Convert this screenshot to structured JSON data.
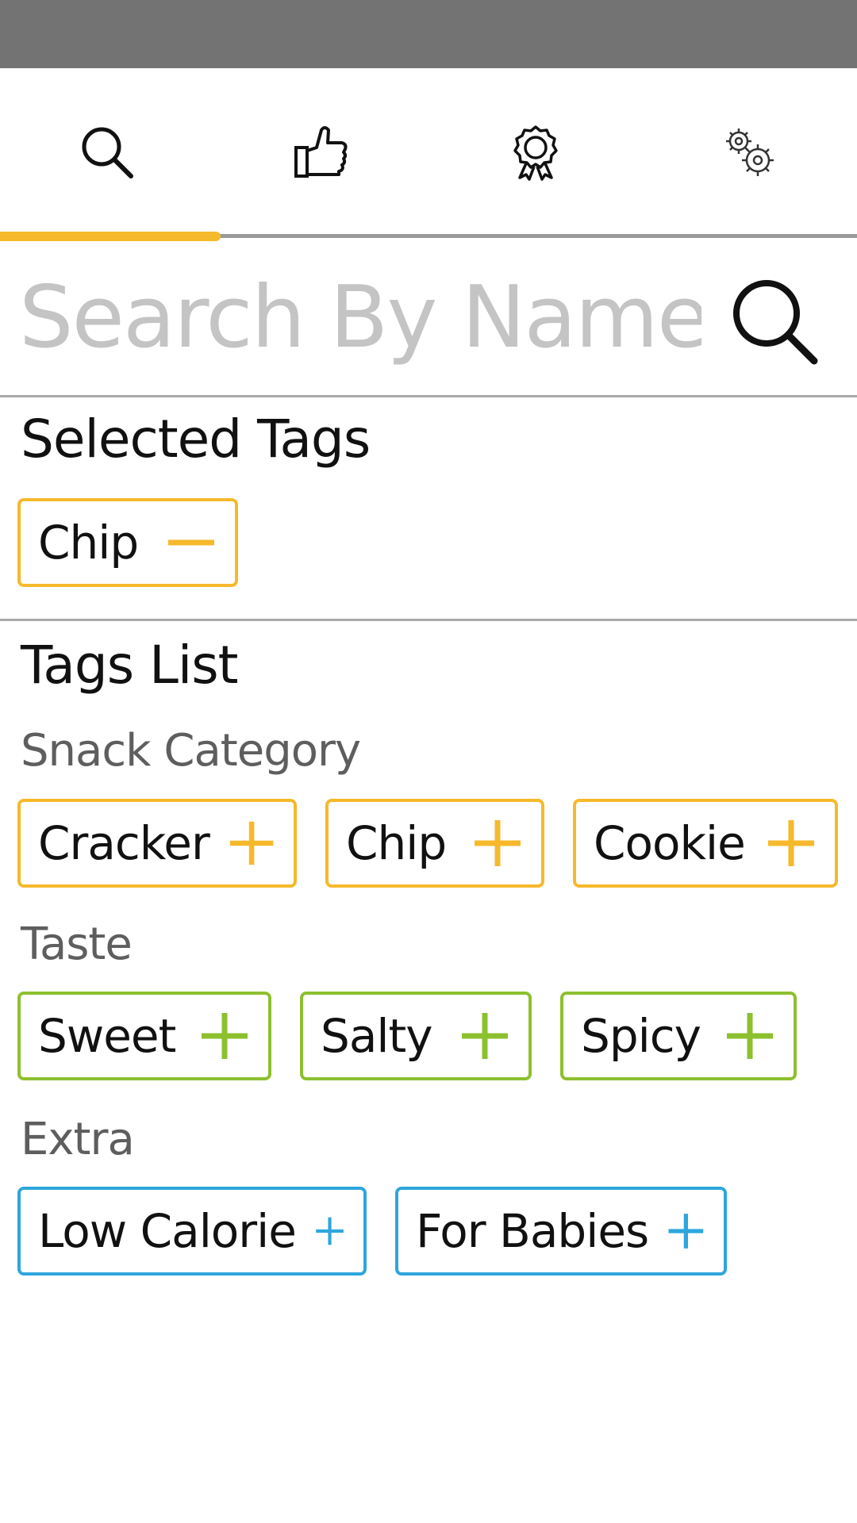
{
  "colors": {
    "accent_yellow": "#f6b92c",
    "accent_green": "#8dc02f",
    "accent_blue": "#2ea6dd",
    "divider": "#a9a9a9"
  },
  "tabs": [
    {
      "icon": "search-icon",
      "active": true
    },
    {
      "icon": "thumbs-up-icon",
      "active": false
    },
    {
      "icon": "award-badge-icon",
      "active": false
    },
    {
      "icon": "gears-icon",
      "active": false
    }
  ],
  "search": {
    "placeholder": "Search By Name",
    "value": ""
  },
  "selected_tags": {
    "title": "Selected Tags",
    "tags": [
      {
        "label": "Chip",
        "action": "minus-icon"
      }
    ]
  },
  "tags_list": {
    "title": "Tags List",
    "groups": [
      {
        "label": "Snack Category",
        "color": "#f6b92c",
        "tags": [
          {
            "label": "Cracker"
          },
          {
            "label": "Chip"
          },
          {
            "label": "Cookie"
          }
        ]
      },
      {
        "label": "Taste",
        "color": "#8dc02f",
        "tags": [
          {
            "label": "Sweet"
          },
          {
            "label": "Salty"
          },
          {
            "label": "Spicy"
          }
        ]
      },
      {
        "label": "Extra",
        "color": "#2ea6dd",
        "tags": [
          {
            "label": "Low Calorie"
          },
          {
            "label": "For Babies"
          }
        ]
      }
    ]
  }
}
